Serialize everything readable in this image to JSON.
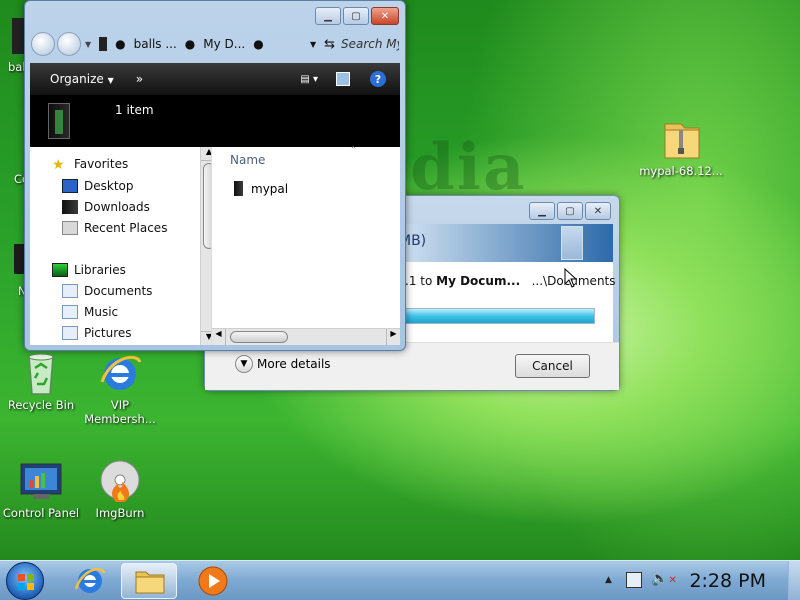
{
  "desktop": {
    "watermark": "dia",
    "icons": [
      {
        "label": "Recycle Bin"
      },
      {
        "label": "VIP Membersh..."
      },
      {
        "label": "Control Panel"
      },
      {
        "label": "ImgBurn"
      },
      {
        "label": "mypal-68.12..."
      }
    ],
    "partial_labels": [
      "bal",
      "Co",
      "N"
    ]
  },
  "explorer": {
    "breadcrumb": [
      "balls ...",
      "My D..."
    ],
    "search_placeholder": "Search My",
    "toolbar": {
      "organize": "Organize",
      "more": "»"
    },
    "details": {
      "count": "1 item"
    },
    "nav": {
      "favorites": "Favorites",
      "desktop": "Desktop",
      "downloads": "Downloads",
      "recent": "Recent Places",
      "libraries": "Libraries",
      "documents": "Documents",
      "music": "Music",
      "pictures": "Pictures"
    },
    "content": {
      "column_name": "Name",
      "items": [
        "mypal"
      ]
    }
  },
  "copy_dialog": {
    "header_fragment": "MB)",
    "line_prefix": ".1",
    "line_to": "to",
    "dest_bold": "My Docum...",
    "dest_path": "...\\Documents",
    "progress": 1.0,
    "more_details": "More details",
    "cancel": "Cancel"
  },
  "taskbar": {
    "clock": "2:28 PM"
  },
  "colors": {
    "accent": "#1b7a1b",
    "progress": "#3fc2e6"
  }
}
